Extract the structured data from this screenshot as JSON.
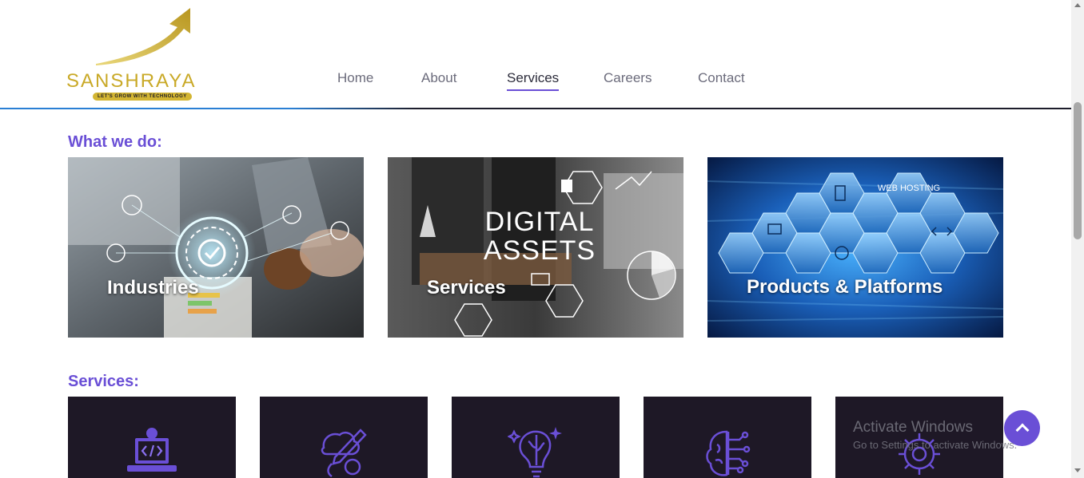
{
  "brand": {
    "name": "SANSHRAYA",
    "tagline": "LET'S GROW WITH TECHNOLOGY",
    "colors": {
      "gold": "#c9a927",
      "accent": "#6a4fd6",
      "dark_tile": "#1e1826"
    }
  },
  "nav": {
    "items": [
      {
        "label": "Home"
      },
      {
        "label": "About"
      },
      {
        "label": "Services",
        "active": true
      },
      {
        "label": "Careers"
      },
      {
        "label": "Contact"
      }
    ]
  },
  "what_we_do": {
    "title": "What we do:",
    "cards": [
      {
        "label": "Industries",
        "image": "industries-photo"
      },
      {
        "label": "Services",
        "image": "digital-assets-photo",
        "image_text_line1": "DIGITAL",
        "image_text_line2": "ASSETS"
      },
      {
        "label": "Products & Platforms",
        "image": "web-hosting-hexagons-photo",
        "image_text": "WEB HOSTING"
      }
    ]
  },
  "services": {
    "title": "Services:",
    "tiles": [
      {
        "icon": "laptop-code-icon"
      },
      {
        "icon": "creative-design-icon"
      },
      {
        "icon": "idea-brain-icon"
      },
      {
        "icon": "ai-chip-brain-icon"
      },
      {
        "icon": "gear-settings-icon"
      }
    ]
  },
  "scroll_to_top": {
    "icon": "chevron-up-icon"
  },
  "windows_overlay": {
    "title": "Activate Windows",
    "subtitle": "Go to Settings to activate Windows."
  }
}
